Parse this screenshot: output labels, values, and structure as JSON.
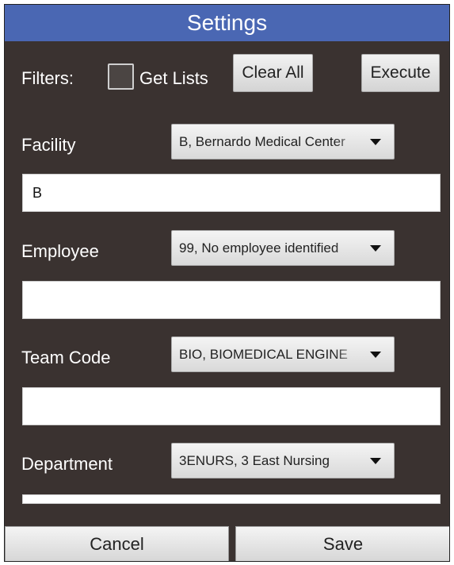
{
  "title": "Settings",
  "filters": {
    "label": "Filters:",
    "get_lists_label": "Get Lists",
    "clear_all_label": "Clear All",
    "execute_label": "Execute"
  },
  "facility": {
    "label": "Facility",
    "selected": "B, Bernardo Medical Center",
    "input_value": "B"
  },
  "employee": {
    "label": "Employee",
    "selected": "99, No employee identified",
    "input_value": ""
  },
  "team_code": {
    "label": "Team Code",
    "selected": "BIO, BIOMEDICAL ENGINE",
    "input_value": ""
  },
  "department": {
    "label": "Department",
    "selected": "3ENURS, 3 East Nursing",
    "input_value": ""
  },
  "footer": {
    "cancel_label": "Cancel",
    "save_label": "Save"
  }
}
